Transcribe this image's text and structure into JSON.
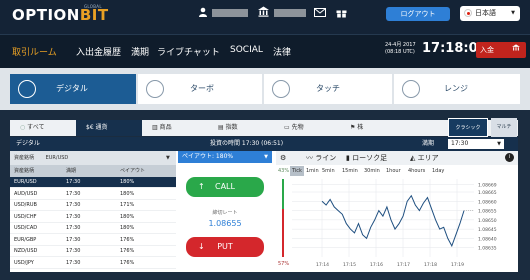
{
  "brand": {
    "name_part1": "OPTION",
    "name_part2": "BIT",
    "subtitle": "GLOBAL"
  },
  "header": {
    "logout_label": "ログアウト",
    "language_label": "日本語"
  },
  "nav": {
    "items": [
      "取引ルーム",
      "入出金履歴",
      "満期",
      "ライブチャット",
      "SOCIAL",
      "法律"
    ],
    "date_line1": "24-4月 2017",
    "date_line2": "(08:18 UTC)",
    "clock": "17:18:09",
    "deposit_label": "入金"
  },
  "modes": [
    "デジタル",
    "ターボ",
    "タッチ",
    "レンジ"
  ],
  "asset_tabs": [
    "すべて",
    "通貨",
    "商品",
    "指数",
    "先物",
    "株"
  ],
  "view_toggle": {
    "chart": "クラシック",
    "multi": "マルチ"
  },
  "panel": {
    "title": "デジタル",
    "investment_time": "投資の時間 17:30 (06:51)",
    "expiry_label": "満期",
    "expiry_value": "17:30"
  },
  "asset_list": {
    "filter_label": "資産銘柄",
    "filter_value": "EUR/USD",
    "headers": [
      "資産銘柄",
      "満期",
      "ペイアウト"
    ],
    "rows": [
      {
        "asset": "EUR/USD",
        "expiry": "17:30",
        "payout": "180%"
      },
      {
        "asset": "AUD/USD",
        "expiry": "17:30",
        "payout": "180%"
      },
      {
        "asset": "USD/RUB",
        "expiry": "17:30",
        "payout": "171%"
      },
      {
        "asset": "USD/CHF",
        "expiry": "17:30",
        "payout": "180%"
      },
      {
        "asset": "USD/CAD",
        "expiry": "17:30",
        "payout": "180%"
      },
      {
        "asset": "EUR/GBP",
        "expiry": "17:30",
        "payout": "176%"
      },
      {
        "asset": "NZD/USD",
        "expiry": "17:30",
        "payout": "176%"
      },
      {
        "asset": "USD/JPY",
        "expiry": "17:30",
        "payout": "176%"
      }
    ]
  },
  "trade": {
    "payout_label": "ペイアウト: 180%",
    "call_label": "CALL",
    "put_label": "PUT",
    "rate_label": "締切レート",
    "rate_value": "1.08655"
  },
  "chart_tools": {
    "line_label": "ライン",
    "candle_label": "ローソク足",
    "area_label": "エリア",
    "call_pct": "43%",
    "put_pct": "57%",
    "intervals": [
      "Tick",
      "1min",
      "5min",
      "15min",
      "30min",
      "1hour",
      "4hours",
      "1day"
    ]
  },
  "chart_data": {
    "type": "line",
    "x": [
      "17:14",
      "17:15",
      "17:16",
      "17:17",
      "17:18",
      "17:19"
    ],
    "y_ticks": [
      "1.08669",
      "1.08665",
      "1.08660",
      "1.08655",
      "1.08650",
      "1.08645",
      "1.08640",
      "1.08635"
    ],
    "ylim": [
      1.0863,
      1.08672
    ],
    "series": [
      {
        "values": [
          1.0866,
          1.08658,
          1.08661,
          1.08657,
          1.08655,
          1.08653,
          1.08648,
          1.08645,
          1.08643,
          1.08648,
          1.08642,
          1.0864,
          1.08646,
          1.0865,
          1.08655,
          1.08652,
          1.08657,
          1.0865,
          1.08645,
          1.08648,
          1.08652,
          1.0866,
          1.08663,
          1.08658,
          1.08655,
          1.08659,
          1.08662,
          1.08656,
          1.0865,
          1.08645,
          1.08646,
          1.0864,
          1.08636,
          1.08642,
          1.08648,
          1.08655
        ]
      }
    ],
    "grid": true
  },
  "colors": {
    "accent": "#e8a024",
    "call": "#2aa84a",
    "put": "#d4272c",
    "primary": "#2e7fd6"
  }
}
